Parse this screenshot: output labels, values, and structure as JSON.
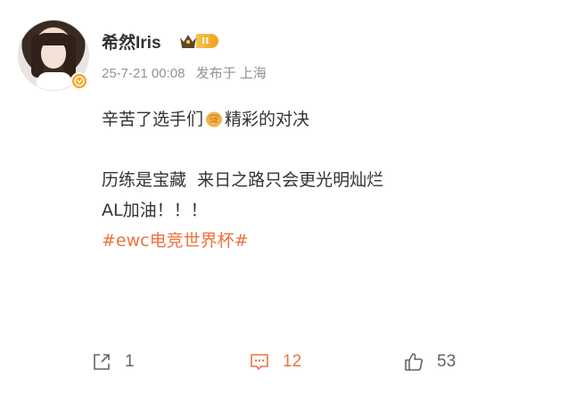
{
  "author": {
    "name": "希然Iris",
    "level_badge": "II",
    "verified_icon": "v-badge-icon"
  },
  "meta": {
    "time": "25-7-21 00:08",
    "location": "发布于 上海"
  },
  "content": {
    "line1_a": "辛苦了选手们",
    "line1_emoji": "fist-emoji-icon",
    "line1_b": "精彩的对决",
    "line2": "历练是宝藏  来日之路只会更光明灿烂",
    "line3": "AL加油！！！",
    "hashtag": "#ewc电竞世界杯#"
  },
  "actions": {
    "share_count": "1",
    "comment_count": "12",
    "like_count": "53"
  },
  "colors": {
    "accent": "#eb7340",
    "badge_gold": "#f7a11a",
    "muted": "#939393"
  }
}
